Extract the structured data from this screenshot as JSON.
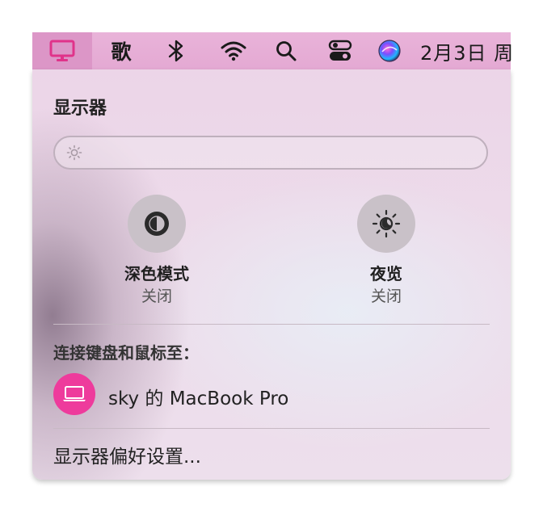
{
  "menubar": {
    "ge_label": "歌",
    "date_label": "2月3日 周"
  },
  "panel": {
    "title": "显示器",
    "dark_mode": {
      "label": "深色模式",
      "state": "关闭"
    },
    "night_shift": {
      "label": "夜览",
      "state": "关闭"
    },
    "connect_header": "连接键盘和鼠标至：",
    "device_name": "sky 的 MacBook Pro",
    "prefs_label": "显示器偏好设置..."
  },
  "colors": {
    "menubar": "#e6add5",
    "menubar_active": "#dc96c7",
    "device_accent": "#ee3b9c",
    "display_icon": "#e0338a"
  },
  "icons": [
    "display-icon",
    "bluetooth-icon",
    "wifi-icon",
    "search-icon",
    "control-center-icon",
    "siri-icon",
    "brightness-icon",
    "dark-mode-icon",
    "night-shift-icon",
    "laptop-icon"
  ]
}
